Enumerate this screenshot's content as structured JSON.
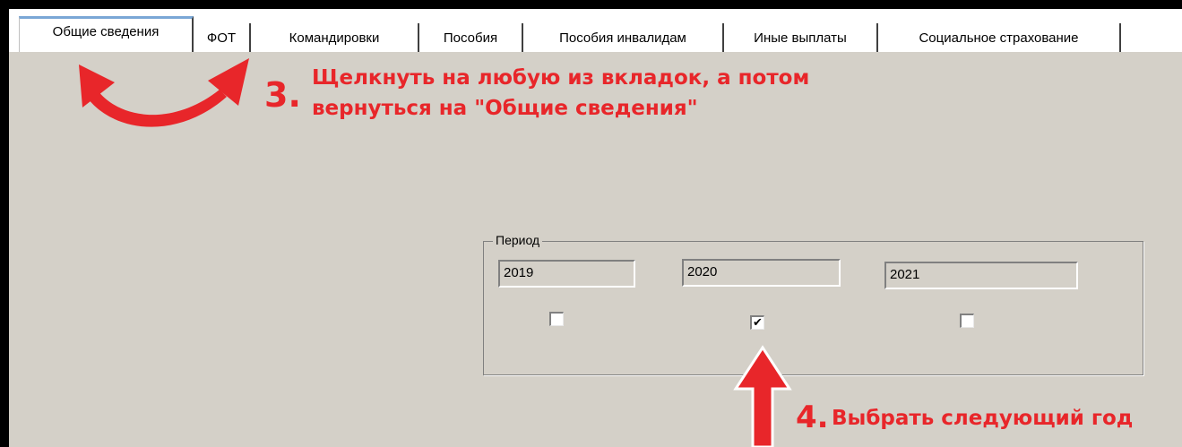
{
  "tabs": [
    {
      "label": "Общие сведения",
      "active": true
    },
    {
      "label": "ФОТ",
      "active": false
    },
    {
      "label": "Командировки",
      "active": false
    },
    {
      "label": "Пособия",
      "active": false
    },
    {
      "label": "Пособия инвалидам",
      "active": false
    },
    {
      "label": "Иные выплаты",
      "active": false
    },
    {
      "label": "Социальное страхование",
      "active": false
    }
  ],
  "period": {
    "legend": "Период",
    "years": [
      {
        "value": "2019",
        "checked": false
      },
      {
        "value": "2020",
        "checked": true
      },
      {
        "value": "2021",
        "checked": false
      }
    ]
  },
  "annotations": {
    "step3_number": "3.",
    "step3_line1": "Щелкнуть на любую из вкладок, а потом",
    "step3_line2": "вернуться на \"Общие сведения\"",
    "step4_number": "4.",
    "step4_text": "Выбрать следующий год"
  },
  "colors": {
    "annotation_red": "#e8262a",
    "window_bg": "#d4d0c8",
    "frame": "#000000"
  },
  "icons": {
    "check_glyph": "✔",
    "curved_arrow": "curved-double-arrow-icon",
    "up_arrow": "up-arrow-icon"
  }
}
